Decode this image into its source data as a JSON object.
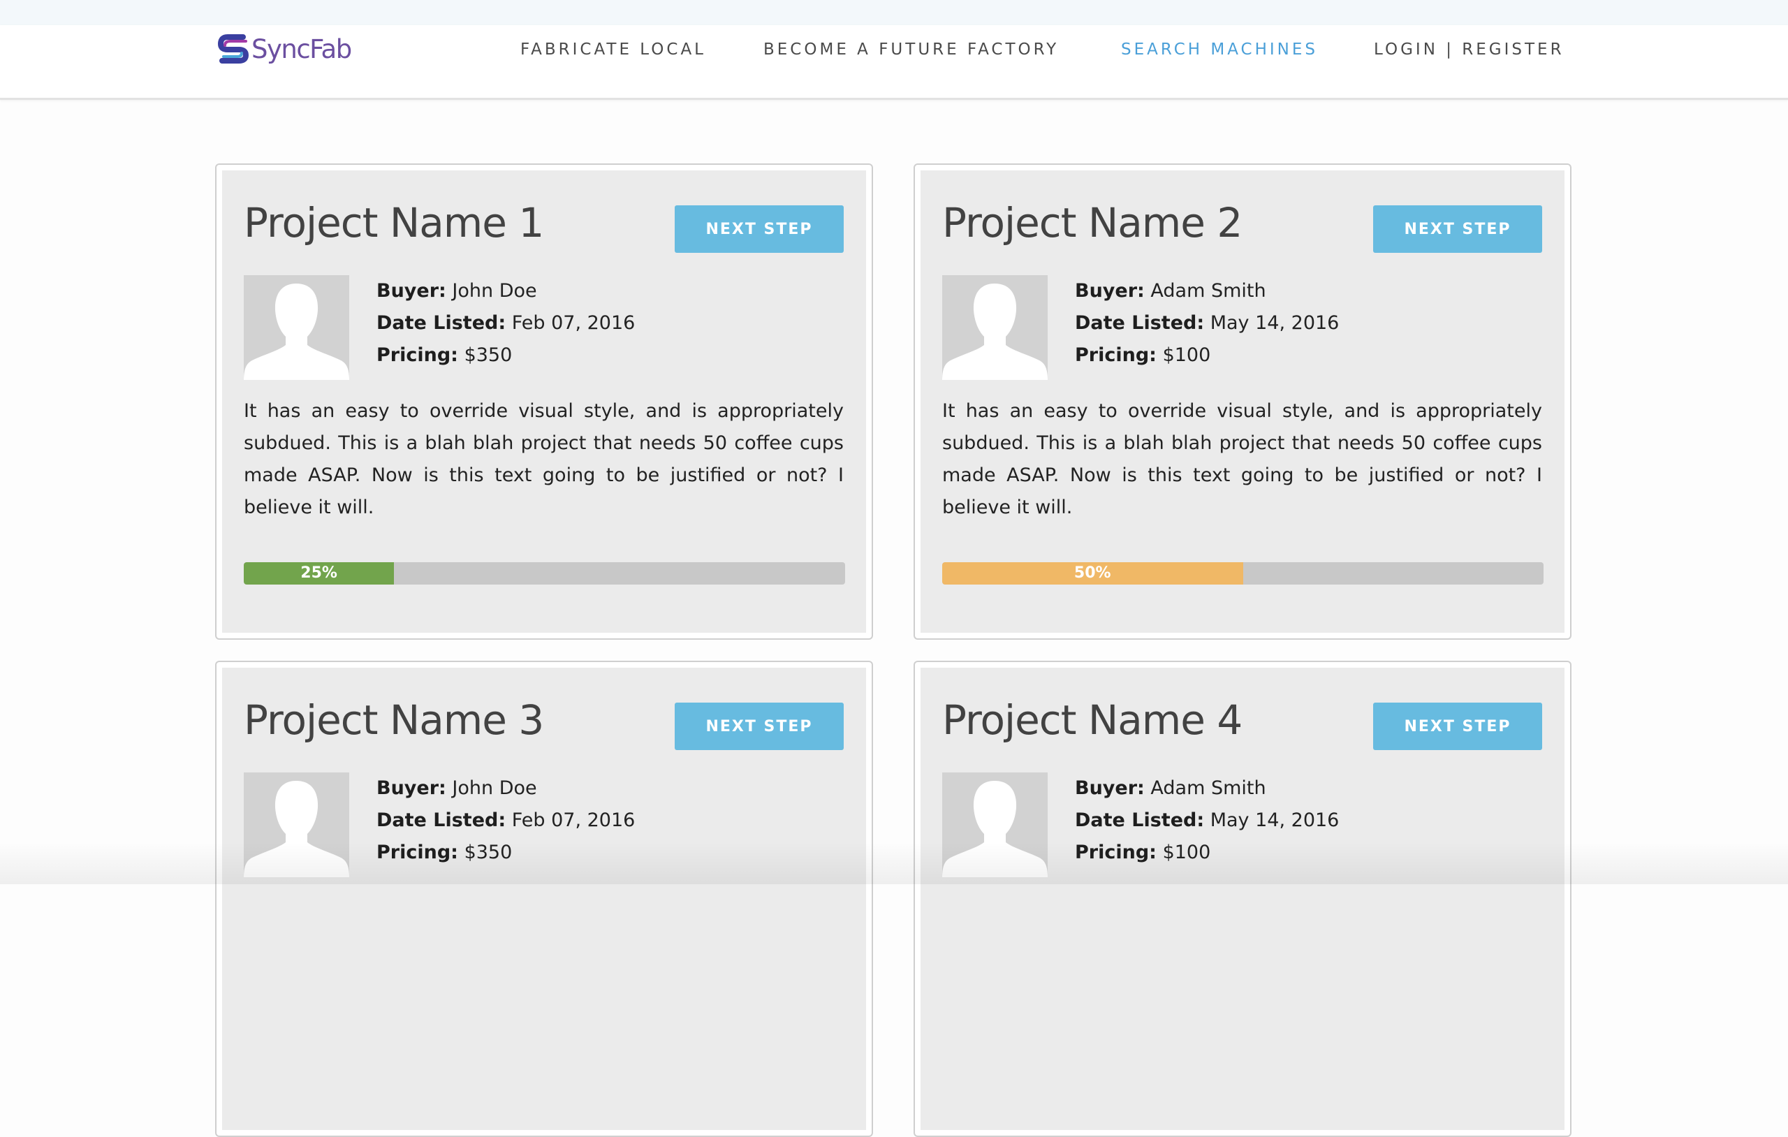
{
  "brand": {
    "name": "SyncFab",
    "logo_colors": [
      "#3a3fa0",
      "#a23aa6",
      "#4aa6d8"
    ]
  },
  "nav": {
    "links": [
      {
        "label": "FABRICATE LOCAL",
        "active": false
      },
      {
        "label": "BECOME A FUTURE FACTORY",
        "active": false
      },
      {
        "label": "SEARCH MACHINES",
        "active": true
      },
      {
        "label": "LOGIN | REGISTER",
        "active": false
      }
    ]
  },
  "labels": {
    "buyer": "Buyer:",
    "date": "Date Listed:",
    "pricing": "Pricing:"
  },
  "projects": [
    {
      "title": "Project Name 1",
      "button": "NEXT STEP",
      "buyer": "John Doe",
      "date": "Feb 07, 2016",
      "pricing": "$350",
      "description": "It has an easy to override visual style, and is appropriately subdued. This is a blah blah project that needs 50 coffee cups made ASAP. Now is this text going to be justified or not? I believe it will.",
      "progress_label": "25%",
      "progress": 25,
      "progress_color": "#72a44c"
    },
    {
      "title": "Project Name 2",
      "button": "NEXT STEP",
      "buyer": "Adam Smith",
      "date": "May 14, 2016",
      "pricing": "$100",
      "description": "It has an easy to override visual style, and is appropriately subdued. This is a blah blah project that needs 50 coffee cups made ASAP. Now is this text going to be justified or not? I believe it will.",
      "progress_label": "50%",
      "progress": 50,
      "progress_color": "#f0b866"
    },
    {
      "title": "Project Name 3",
      "button": "NEXT STEP",
      "buyer": "John Doe",
      "date": "Feb 07, 2016",
      "pricing": "$350"
    },
    {
      "title": "Project Name 4",
      "button": "NEXT STEP",
      "buyer": "Adam Smith",
      "date": "May 14, 2016",
      "pricing": "$100"
    }
  ],
  "colors": {
    "accent": "#67bbe0",
    "nav_active": "#4a9fd8",
    "card_bg": "#ebebeb",
    "avatar_bg": "#d2d2d2"
  }
}
